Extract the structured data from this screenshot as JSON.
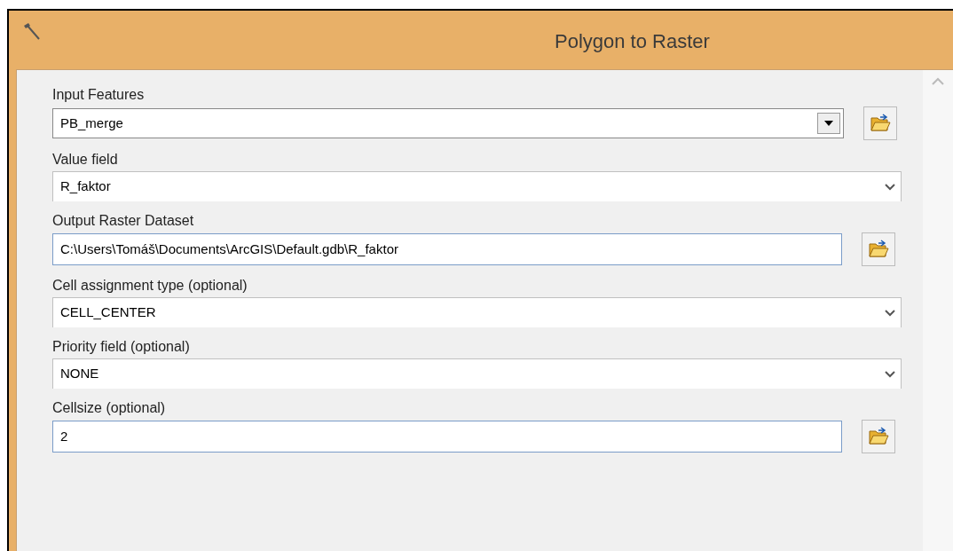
{
  "window": {
    "title": "Polygon to Raster"
  },
  "parameters": [
    {
      "label": "Input Features",
      "value": "PB_merge",
      "kind": "combo"
    },
    {
      "label": "Value field",
      "value": "R_faktor",
      "kind": "dropdown"
    },
    {
      "label": "Output Raster Dataset",
      "value": "C:\\Users\\Tomáš\\Documents\\ArcGIS\\Default.gdb\\R_faktor",
      "kind": "path"
    },
    {
      "label": "Cell assignment type (optional)",
      "value": "CELL_CENTER",
      "kind": "dropdown"
    },
    {
      "label": "Priority field (optional)",
      "value": "NONE",
      "kind": "dropdown"
    },
    {
      "label": "Cellsize (optional)",
      "value": "2",
      "kind": "path"
    }
  ]
}
